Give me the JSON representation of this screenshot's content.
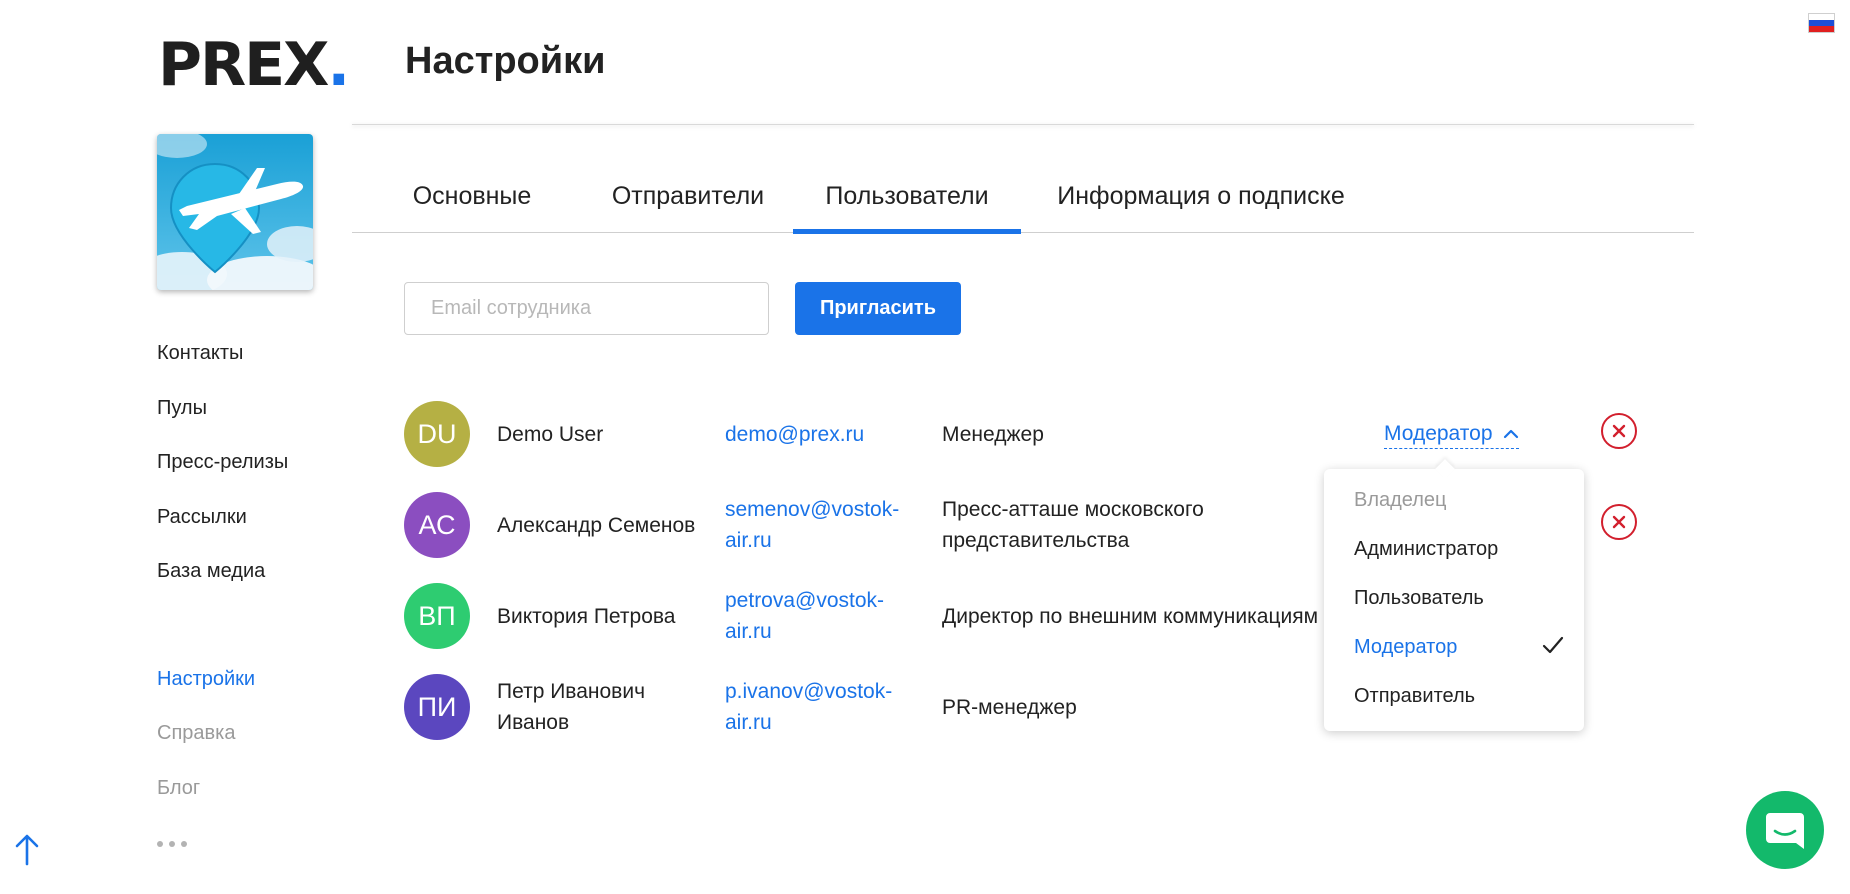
{
  "brand": {
    "logo_text": "PREX",
    "logo_dot": ".",
    "accent_color": "#1a73e8"
  },
  "page": {
    "title": "Настройки"
  },
  "language": {
    "flag": "ru-flag-icon",
    "colors": [
      "#ffffff",
      "#1c4fd8",
      "#e02020"
    ]
  },
  "company": {
    "image": "airplane-pin-logo"
  },
  "sidebar": {
    "items": [
      {
        "label": "Контакты"
      },
      {
        "label": "Пулы"
      },
      {
        "label": "Пресс-релизы"
      },
      {
        "label": "Рассылки"
      },
      {
        "label": "База медиа"
      },
      {
        "label": "Настройки",
        "active": true
      },
      {
        "label": "Справка"
      },
      {
        "label": "Блог"
      }
    ],
    "more_icon": "more-dots-icon"
  },
  "tabs": [
    {
      "label": "Основные"
    },
    {
      "label": "Отправители"
    },
    {
      "label": "Пользователи",
      "active": true
    },
    {
      "label": "Информация о подписке"
    }
  ],
  "invite": {
    "placeholder": "Email сотрудника",
    "value": "",
    "button_label": "Пригласить"
  },
  "users": [
    {
      "initials": "DU",
      "name": "Demo User",
      "email": "demo@prex.ru",
      "position": "Менеджер",
      "role": "Модератор",
      "avatar_color": "#b5b044"
    },
    {
      "initials": "АС",
      "name": "Александр Семенов",
      "email": "semenov@vostok-air.ru",
      "position": "Пресс-атташе московского представительства",
      "avatar_color": "#8b4ec0"
    },
    {
      "initials": "ВП",
      "name": "Виктория Петрова",
      "email": "petrova@vostok-air.ru",
      "position": "Директор по внешним коммуникациям",
      "avatar_color": "#2ecc71"
    },
    {
      "initials": "ПИ",
      "name": "Петр Иванович Иванов",
      "email": "p.ivanov@vostok-air.ru",
      "position": "PR-менеджер",
      "avatar_color": "#5b47bf"
    }
  ],
  "role_dropdown": {
    "options": [
      {
        "label": "Владелец",
        "disabled": true
      },
      {
        "label": "Администратор"
      },
      {
        "label": "Пользователь"
      },
      {
        "label": "Модератор",
        "selected": true
      },
      {
        "label": "Отправитель"
      }
    ]
  },
  "remove_color": "#d21f2d",
  "chat": {
    "icon": "chat-icon",
    "color": "#13b96b"
  },
  "scroll_top_icon": "arrow-up-icon"
}
